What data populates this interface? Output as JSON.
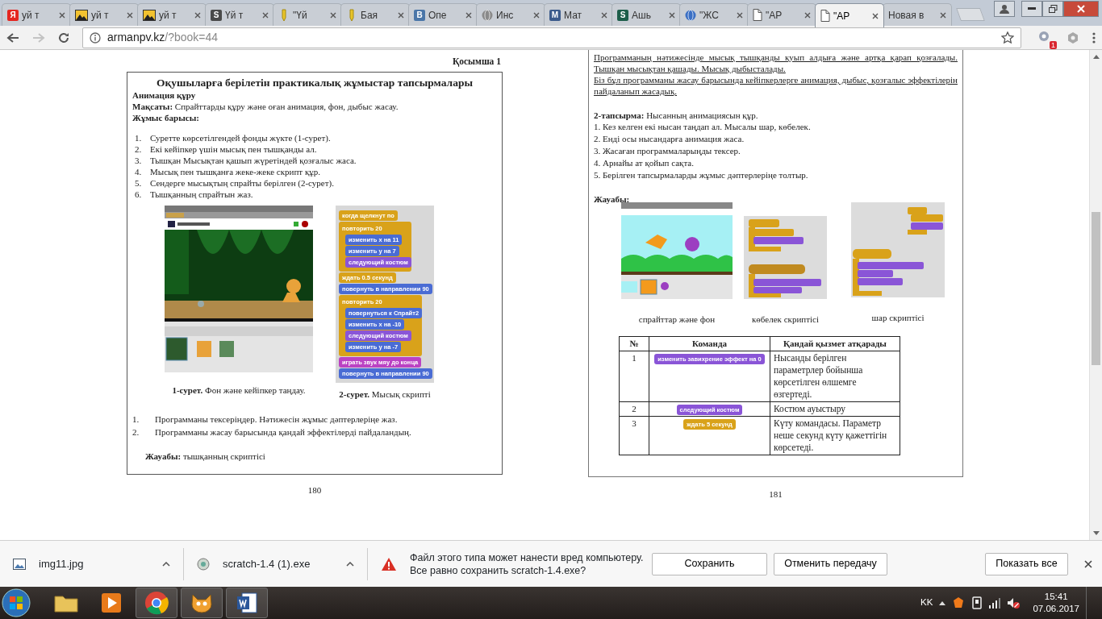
{
  "browser": {
    "tabs": [
      {
        "title": "уй т",
        "selected": false,
        "icon": {
          "kind": "letter",
          "glyph": "Я",
          "color": "#e52620"
        }
      },
      {
        "title": "уй т",
        "selected": false,
        "icon": {
          "kind": "image"
        }
      },
      {
        "title": "уй т",
        "selected": false,
        "icon": {
          "kind": "image"
        }
      },
      {
        "title": "Үй т",
        "selected": false,
        "icon": {
          "kind": "letter",
          "glyph": "S",
          "color": "#4a4a4a"
        }
      },
      {
        "title": "\"Үй",
        "selected": false,
        "icon": {
          "kind": "mark",
          "color": "#e8c42a"
        }
      },
      {
        "title": "Бая",
        "selected": false,
        "icon": {
          "kind": "mark",
          "color": "#e8c42a"
        }
      },
      {
        "title": "Опе",
        "selected": false,
        "icon": {
          "kind": "letter",
          "glyph": "B",
          "color": "#4a76a8"
        }
      },
      {
        "title": "Инс",
        "selected": false,
        "icon": {
          "kind": "globe",
          "color": "#8a8a8a"
        }
      },
      {
        "title": "Мат",
        "selected": false,
        "icon": {
          "kind": "letter",
          "glyph": "M",
          "color": "#3b5b8c"
        }
      },
      {
        "title": "Ашь",
        "selected": false,
        "icon": {
          "kind": "letter",
          "glyph": "S",
          "color": "#1d5e4a"
        }
      },
      {
        "title": "\"ЖС",
        "selected": false,
        "icon": {
          "kind": "globe",
          "color": "#3a6fc4"
        }
      },
      {
        "title": "\"АР",
        "selected": false,
        "icon": {
          "kind": "page"
        }
      },
      {
        "title": "\"АР",
        "selected": true,
        "icon": {
          "kind": "page"
        }
      },
      {
        "title": "Новая в",
        "selected": false,
        "icon": {
          "kind": "none"
        }
      }
    ],
    "nav": {
      "back_enabled": true,
      "forward_enabled": false
    },
    "address": {
      "host": "armanpv.kz",
      "path": "/?book=44"
    },
    "extension_badge": "1"
  },
  "pages": [
    {
      "appendix_label": "Қосымша 1",
      "title": "Оқушыларға берілетін практикалық  жұмыстар тапсырмалары",
      "subtitle": "Анимация құру",
      "goal": "**Мақсаты:** Спрайттарды құру және оған анимация, фон, дыбыс жасау.",
      "process_heading": "Жұмыс барысы:",
      "steps": [
        {
          "num": "1.",
          "text": "Суретте көрсетілгендей фонды жүкте (1-сурет)."
        },
        {
          "num": "2.",
          "text": "Екі кейіпкер үшін мысық пен тышқанды ал."
        },
        {
          "num": "3.",
          "text": "Тышқан Мысықтан қашып жүретіндей қозғалыс жаса."
        },
        {
          "num": "4.",
          "text": "Мысық пен тышқанға жеке-жеке скрипт құр."
        },
        {
          "num": "5.",
          "text": "Сендерге мысықтың спрайты берілген (2-сурет)."
        },
        {
          "num": "6.",
          "text": "Тышқанның  спрайтын жаз."
        }
      ],
      "figures": [
        {
          "kind": "theater-stage",
          "caption": "**1-сурет.** Фон және кейіпкер таңдау."
        },
        {
          "kind": "script-blocks",
          "caption": "**2-сурет.** Мысық скрипті",
          "blocks": [
            {
              "text": "когда щелкнут по",
              "color": "#d9a21a"
            },
            {
              "text": "повторить 20",
              "color": "#d9a21a",
              "children": [
                {
                  "text": "изменить x на 11",
                  "color": "#4a6cd4"
                },
                {
                  "text": "изменить y на 7",
                  "color": "#4a6cd4"
                },
                {
                  "text": "следующий костюм",
                  "color": "#8a55d7"
                }
              ]
            },
            {
              "text": "ждать 0.5 секунд",
              "color": "#d9a21a"
            },
            {
              "text": "повернуть в направлении 90",
              "color": "#4a6cd4"
            },
            {
              "text": "повторить 20",
              "color": "#d9a21a",
              "children": [
                {
                  "text": "повернуться к Спрайт2",
                  "color": "#4a6cd4"
                },
                {
                  "text": "изменить x на -10",
                  "color": "#4a6cd4"
                },
                {
                  "text": "следующий костюм",
                  "color": "#8a55d7"
                },
                {
                  "text": "изменить y на -7",
                  "color": "#4a6cd4"
                }
              ]
            },
            {
              "text": "играть звук мяу до конца",
              "color": "#bb42c3"
            },
            {
              "text": "повернуть в направлении 90",
              "color": "#4a6cd4"
            }
          ]
        }
      ],
      "questions": [
        {
          "num": "1.",
          "text": "Программаны тексеріңдер. Нәтижесін жұмыс дәптерлеріңе жаз."
        },
        {
          "num": "2.",
          "text": "Программаны жасау барысында қандай эффектілерді пайдаландың."
        }
      ],
      "answer": "**Жауабы:** тышқанның скриптісі",
      "page_number": "180"
    },
    {
      "paragraphs": [
        {
          "text": "Программаның нәтижесінде мысық тышқанды қуып алдыға және артқа қарап қозғалады. Тышқан мысықтан қашады. Мысық дыбысталады.",
          "underlined": true
        },
        {
          "text": "Біз бұл программаны жасау барысында кейіпкерлерге анимация, дыбыс, қозғалыс эффектілерін пайдаланып жасадық.",
          "underlined": true
        }
      ],
      "task": "**2-тапсырма:**  Нысанның  анимациясын құр.",
      "task_steps": [
        "1. Кез келген  екі нысан таңдап ал. Мысалы шар, көбелек.",
        "2. Енді осы нысандарға анимация жаса.",
        "3. Жасаған программаларыңды тексер.",
        "4. Арнайы ат қойып сақта.",
        "5. Берілген  тапсырмаларды жұмыс дәптерлеріңе толтыр."
      ],
      "answer_heading": "Жауабы:",
      "answer_figures": [
        {
          "kind": "sky-stage",
          "caption": "спрайттар және фон"
        },
        {
          "kind": "butterfly-script",
          "caption": "көбелек скриптісі"
        },
        {
          "kind": "ball-script",
          "caption": "шар скриптісі"
        }
      ],
      "table": {
        "columns": [
          "№",
          "Команда",
          "Қандай қызмет атқарады"
        ],
        "rows": [
          {
            "number": "1",
            "command": {
              "text": "изменить завихрение эффект на 0",
              "color": "#8a55d7"
            },
            "description": "Нысанды берілген параметрлер бойынша көрсетілген өлшемге өзгертеді."
          },
          {
            "number": "2",
            "command": {
              "text": "следующий костюм",
              "color": "#8a55d7"
            },
            "description": "Костюм ауыстыру"
          },
          {
            "number": "3",
            "command": {
              "text": "ждать 5 секунд",
              "color": "#d9a21a"
            },
            "description": "Күту командасы. Параметр неше секунд күту қажеттігін көрсетеді."
          }
        ]
      },
      "page_number": "181"
    }
  ],
  "downloads": {
    "items": [
      {
        "name": "img11.jpg",
        "kind": "image"
      },
      {
        "name": "scratch-1.4 (1).exe",
        "kind": "installer"
      }
    ],
    "warning": "Файл этого типа может нанести вред компьютеру. Все равно сохранить scratch-1.4.exe?",
    "buttons": [
      "Сохранить",
      "Отменить передачу"
    ],
    "show_all": "Показать все"
  },
  "taskbar": {
    "apps": [
      {
        "kind": "explorer",
        "running": false
      },
      {
        "kind": "media",
        "running": false
      },
      {
        "kind": "chrome",
        "running": true
      },
      {
        "kind": "scratch",
        "running": true
      },
      {
        "kind": "word",
        "running": true
      }
    ],
    "language": "KK",
    "time": "15:41",
    "date": "07.06.2017"
  }
}
